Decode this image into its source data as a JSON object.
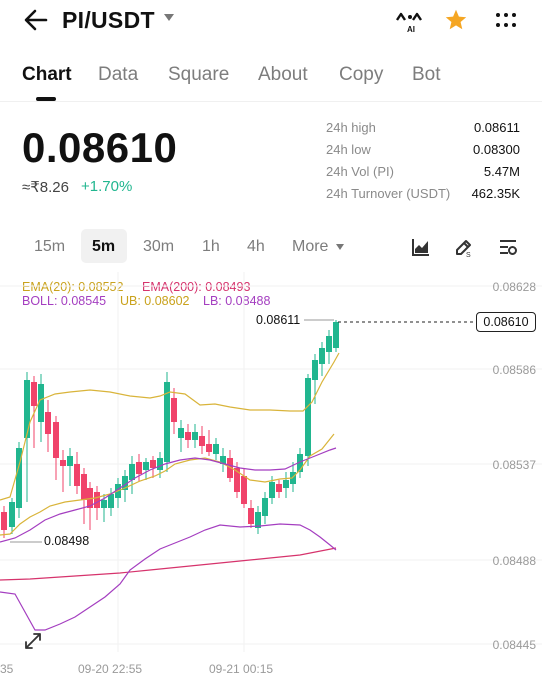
{
  "header": {
    "pair": "PI/USDT"
  },
  "tabs": [
    "Chart",
    "Data",
    "Square",
    "About",
    "Copy",
    "Bot"
  ],
  "price": {
    "last": "0.08610",
    "local": "≈₹8.26",
    "change": "+1.70%"
  },
  "stats": [
    {
      "label": "24h high",
      "value": "0.08611"
    },
    {
      "label": "24h low",
      "value": "0.08300"
    },
    {
      "label": "24h Vol (PI)",
      "value": "5.47M"
    },
    {
      "label": "24h Turnover (USDT)",
      "value": "462.35K"
    }
  ],
  "intervals": {
    "items": [
      "15m",
      "5m",
      "30m",
      "1h",
      "4h"
    ],
    "more": "More"
  },
  "indicators": {
    "ema20": "EMA(20): 0.08552",
    "ema200": "EMA(200): 0.08493",
    "boll": "BOLL: 0.08545",
    "ub": "UB: 0.08602",
    "lb": "LB: 0.08488"
  },
  "chart": {
    "y_axis": [
      "0.08628",
      "0.08586",
      "0.08537",
      "0.08488",
      "0.08445"
    ],
    "x_axis": [
      "35",
      "09-20 22:55",
      "09-21 00:15"
    ],
    "last_price": "0.08610",
    "high_marker": "0.08611",
    "low_marker": "0.08498"
  },
  "colors": {
    "up": "#21b68f",
    "down": "#f0436a",
    "star": "#f5a623",
    "ema20": "#d9b43a",
    "ema200": "#d6336c",
    "boll": "#a43ec0"
  }
}
